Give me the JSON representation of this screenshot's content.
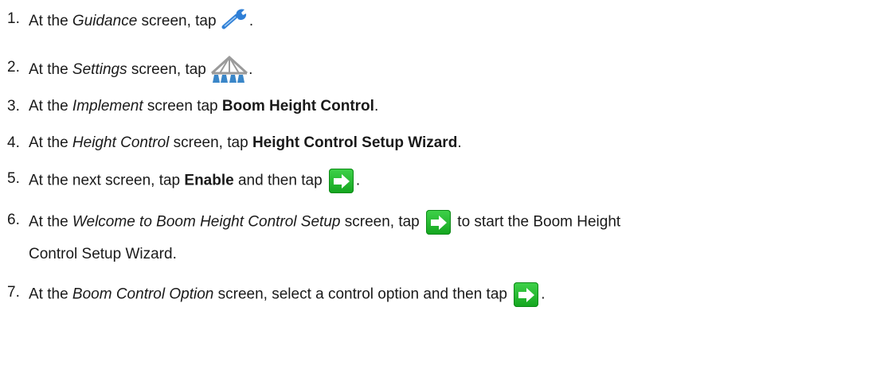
{
  "steps": [
    {
      "num": "1.",
      "a": "At the ",
      "i": "Guidance",
      "b": " screen, tap ",
      "c": "."
    },
    {
      "num": "2.",
      "a": "At the ",
      "i": "Settings",
      "b": " screen, tap ",
      "c": "."
    },
    {
      "num": "3.",
      "a": "At the ",
      "i": "Implement",
      "b": " screen tap ",
      "bold": "Boom Height Control",
      "c": "."
    },
    {
      "num": "4.",
      "a": "At the ",
      "i": "Height Control",
      "b": " screen, tap ",
      "bold": "Height Control Setup Wizard",
      "c": "."
    },
    {
      "num": "5.",
      "a": "At the next screen, tap ",
      "bold": "Enable",
      "b": " and then tap ",
      "c": "."
    },
    {
      "num": "6.",
      "a": "At the ",
      "i": "Welcome to Boom Height Control Setup",
      "b": " screen, tap ",
      "c": " to start the Boom Height",
      "cont": "Control Setup Wizard."
    },
    {
      "num": "7.",
      "a": "At the ",
      "i": "Boom Control Option",
      "b": " screen, select a control option and then tap ",
      "c": "."
    }
  ],
  "icons": {
    "wrench": "wrench-icon",
    "boom": "boom-implement-icon",
    "next": "next-arrow-icon",
    "next_color": "#1fb82b",
    "wrench_color": "#2f7fd6",
    "boom_color": "#3a86c8"
  }
}
